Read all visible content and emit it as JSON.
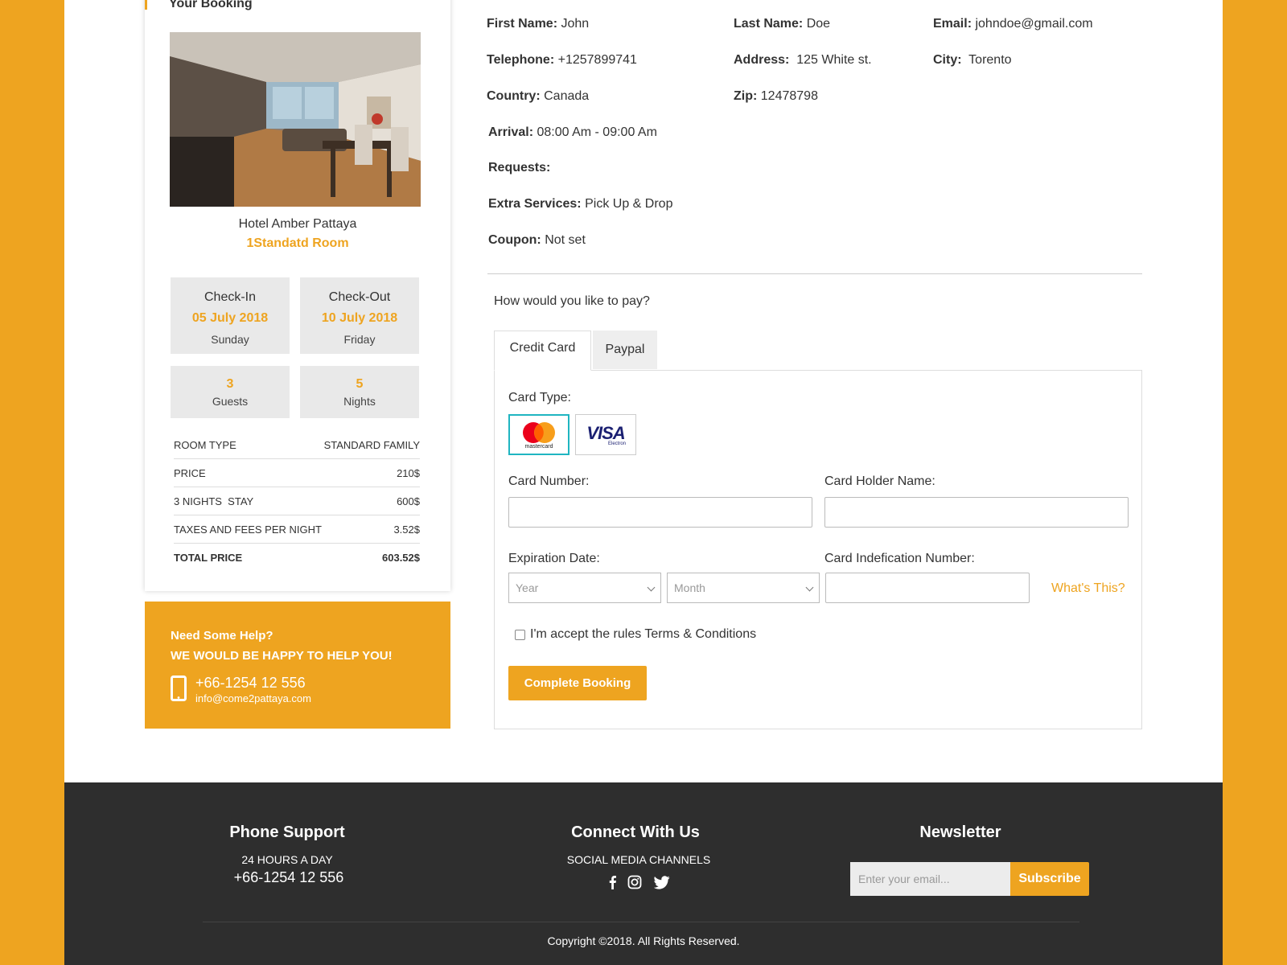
{
  "booking": {
    "title": "Your Booking",
    "hotel_name": "Hotel Amber Pattaya",
    "room_name": "1Standatd Room",
    "checkin": {
      "label": "Check-In",
      "date": "05 July 2018",
      "day": "Sunday"
    },
    "checkout": {
      "label": "Check-Out",
      "date": "10 July 2018",
      "day": "Friday"
    },
    "guests": {
      "value": "3",
      "label": "Guests"
    },
    "nights": {
      "value": "5",
      "label": "Nights"
    },
    "price_table": [
      {
        "label": "ROOM TYPE",
        "value": "STANDARD FAMILY"
      },
      {
        "label": "PRICE",
        "value": "210$"
      },
      {
        "label": "3 NIGHTS  STAY",
        "value": "600$"
      },
      {
        "label": "TAXES AND FEES PER NIGHT",
        "value": "3.52$"
      },
      {
        "label": "TOTAL PRICE",
        "value": "603.52$"
      }
    ]
  },
  "help": {
    "line1": "Need Some Help?",
    "line2": "WE WOULD BE HAPPY TO HELP YOU!",
    "phone": "+66-1254 12 556",
    "email": "info@come2pattaya.com"
  },
  "guest": {
    "first_name": {
      "label": "First Name:",
      "value": "John"
    },
    "last_name": {
      "label": "Last Name:",
      "value": "Doe"
    },
    "email": {
      "label": "Email:",
      "value": "johndoe@gmail.com"
    },
    "telephone": {
      "label": "Telephone:",
      "value": "+1257899741"
    },
    "address": {
      "label": "Address:",
      "value": "125 White st."
    },
    "city": {
      "label": "City:",
      "value": "Torento"
    },
    "country": {
      "label": "Country:",
      "value": "Canada"
    },
    "zip": {
      "label": "Zip:",
      "value": "12478798"
    },
    "arrival": {
      "label": "Arrival:",
      "value": "08:00 Am - 09:00 Am"
    },
    "requests": {
      "label": "Requests:",
      "value": ""
    },
    "extra_services": {
      "label": "Extra Services:",
      "value": "Pick Up & Drop"
    },
    "coupon": {
      "label": "Coupon:",
      "value": "Not set"
    }
  },
  "payment": {
    "question": "How would you like to pay?",
    "tabs": [
      "Credit Card",
      "Paypal"
    ],
    "active_tab": "Credit Card",
    "card_type_label": "Card Type:",
    "card_types": [
      "mastercard",
      "VISA"
    ],
    "visa_sub": "Electron",
    "selected_card": "mastercard",
    "card_number_label": "Card Number:",
    "card_holder_label": "Card Holder Name:",
    "expiration_label": "Expiration Date:",
    "year_placeholder": "Year",
    "month_placeholder": "Month",
    "cin_label": "Card Indefication Number:",
    "whats_this": "What's This?",
    "terms": "I'm accept the rules Terms & Conditions",
    "submit": "Complete Booking"
  },
  "footer": {
    "phone_title": "Phone Support",
    "phone_sub": "24 HOURS A DAY",
    "phone": "+66-1254 12 556",
    "connect_title": "Connect With Us",
    "connect_sub": "SOCIAL MEDIA CHANNELS",
    "newsletter_title": "Newsletter",
    "email_placeholder": "Enter your email...",
    "subscribe": "Subscribe",
    "copyright": "Copyright ©2018. All Rights Reserved."
  },
  "colors": {
    "accent": "#eea420",
    "footer_bg": "#2e2e2e",
    "grey_box": "#e9e9e9",
    "card_selected_border": "#1fb5c1"
  }
}
